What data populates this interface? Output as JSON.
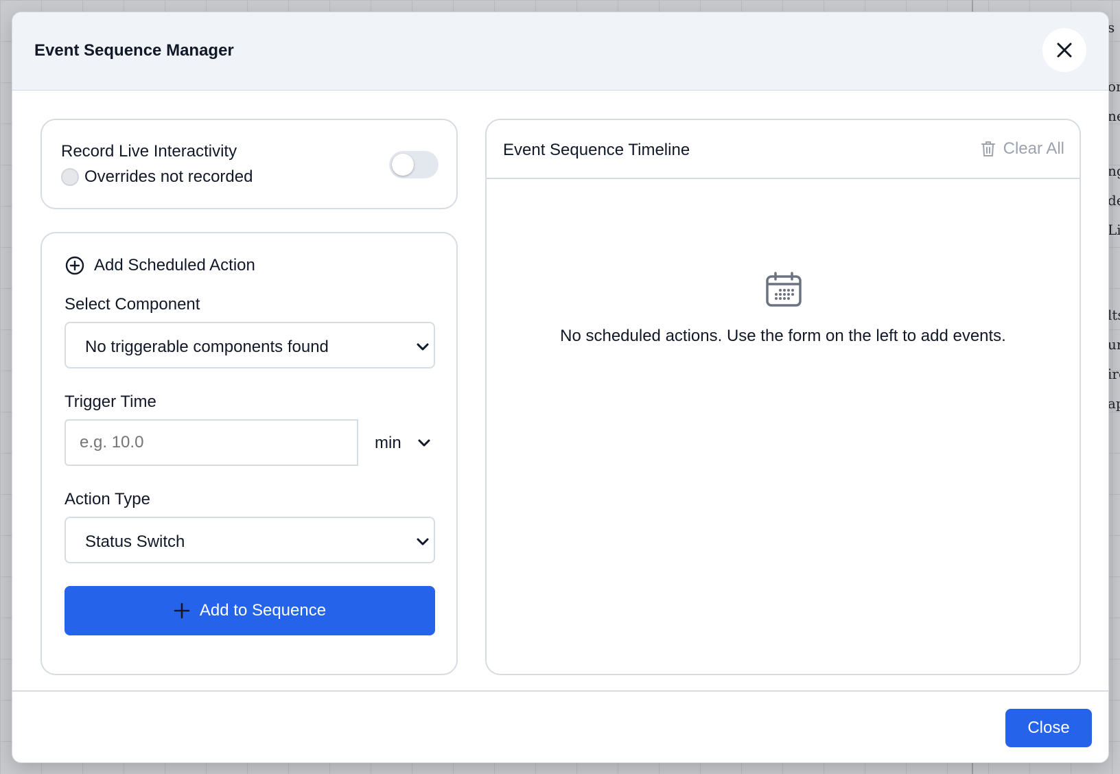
{
  "background": {
    "sidebar_fragments": [
      "s",
      "on",
      "ne",
      "ng",
      "de",
      "Li",
      "lts",
      "ur",
      "ire",
      "ap"
    ]
  },
  "modal": {
    "title": "Event Sequence Manager",
    "close_icon": "close-icon"
  },
  "record": {
    "title": "Record Live Interactivity",
    "status": "Overrides not recorded",
    "toggle_on": false
  },
  "form": {
    "heading": "Add Scheduled Action",
    "component_label": "Select Component",
    "component_value": "No triggerable components found",
    "time_label": "Trigger Time",
    "time_placeholder": "e.g. 10.0",
    "time_value": "",
    "unit_value": "min",
    "action_label": "Action Type",
    "action_value": "Status Switch",
    "add_button": "Add to Sequence"
  },
  "timeline": {
    "title": "Event Sequence Timeline",
    "clear_label": "Clear All",
    "empty_message": "No scheduled actions. Use the form on the left to add events."
  },
  "footer": {
    "close_button": "Close"
  },
  "colors": {
    "accent": "#2563eb",
    "header_bg": "#f0f3f8",
    "border": "#d6dce4",
    "muted": "#9ca3af"
  }
}
